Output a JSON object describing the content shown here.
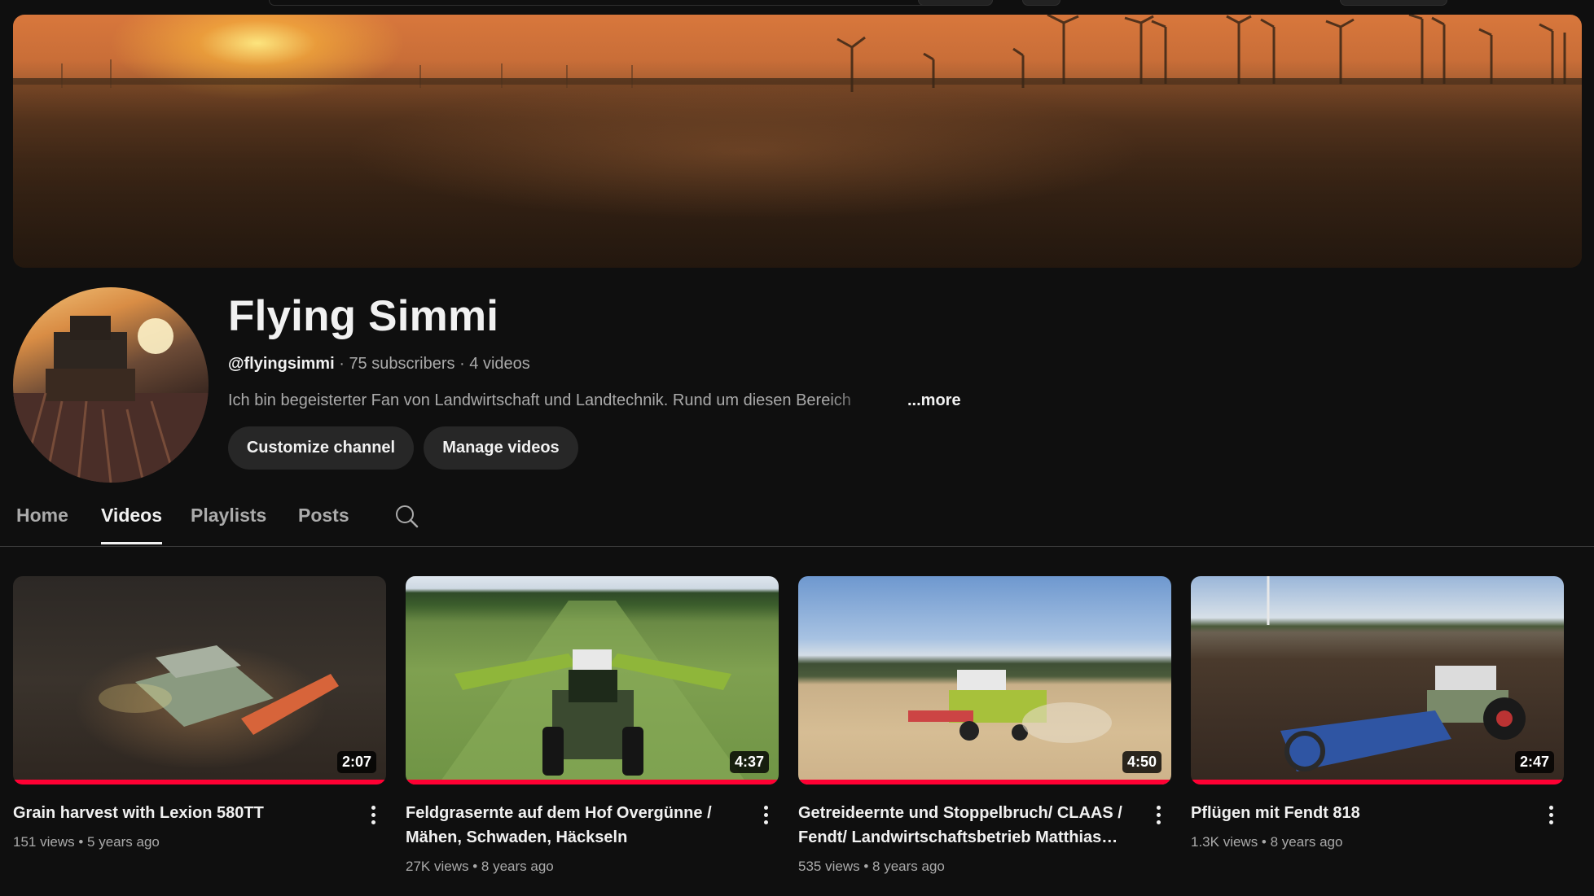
{
  "channel": {
    "name": "Flying Simmi",
    "handle": "@flyingsimmi",
    "subscribers": "75 subscribers",
    "videos_count": "4 videos",
    "separator": "·",
    "description": "Ich bin begeisterter Fan von Landwirtschaft und Landtechnik. Rund um diesen Bereich",
    "more_label": "...more"
  },
  "buttons": {
    "customize": "Customize channel",
    "manage": "Manage videos"
  },
  "tabs": [
    {
      "label": "Home"
    },
    {
      "label": "Videos",
      "active": true
    },
    {
      "label": "Playlists"
    },
    {
      "label": "Posts"
    }
  ],
  "icons": {
    "tab_search": "search-icon",
    "menu": "more-vert-icon"
  },
  "colors": {
    "background": "#0f0f0f",
    "progress": "#ff0033",
    "button_bg": "#272727",
    "secondary_text": "#aaaaaa"
  },
  "videos": [
    {
      "title": "Grain harvest with Lexion 580TT",
      "views": "151 views",
      "age": "5 years ago",
      "duration": "2:07",
      "watched": 1.0
    },
    {
      "title": "Feldgrasernte auf dem Hof Overgünne / Mähen, Schwaden, Häckseln",
      "views": "27K views",
      "age": "8 years ago",
      "duration": "4:37",
      "watched": 1.0
    },
    {
      "title": "Getreideernte und Stoppelbruch/ CLAAS / Fendt/ Landwirtschaftsbetrieb Matthias…",
      "views": "535 views",
      "age": "8 years ago",
      "duration": "4:50",
      "watched": 1.0
    },
    {
      "title": "Pflügen mit Fendt 818",
      "views": "1.3K views",
      "age": "8 years ago",
      "duration": "2:47",
      "watched": 1.0
    }
  ]
}
